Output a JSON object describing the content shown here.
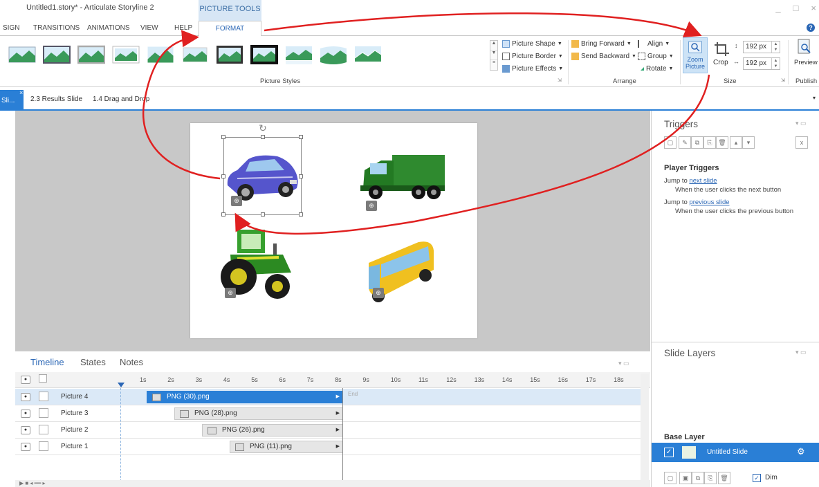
{
  "window": {
    "title": "Untitled1.story* - Articulate Storyline 2",
    "controls": [
      "_",
      "□",
      "×"
    ]
  },
  "ribbon_tabs": {
    "context_group": "PICTURE TOOLS",
    "tabs": [
      "SIGN",
      "TRANSITIONS",
      "ANIMATIONS",
      "VIEW",
      "HELP",
      "FORMAT"
    ]
  },
  "ribbon": {
    "picture_styles_label": "Picture Styles",
    "picture_shape": "Picture Shape",
    "picture_border": "Picture Border",
    "picture_effects": "Picture Effects",
    "bring_forward": "Bring Forward",
    "send_backward": "Send Backward",
    "align": "Align",
    "group": "Group",
    "rotate": "Rotate",
    "arrange_label": "Arrange",
    "zoom_picture": "Zoom Picture",
    "crop": "Crop",
    "height_value": "192 px",
    "width_value": "192 px",
    "size_label": "Size",
    "preview": "Preview",
    "publish_label": "Publish"
  },
  "slide_tabs": {
    "active_tab": "Sli...",
    "tabs": [
      "2.3 Results Slide",
      "1.4 Drag and Drop"
    ]
  },
  "triggers": {
    "title": "Triggers",
    "player_triggers_heading": "Player Triggers",
    "items": [
      {
        "prefix": "Jump to ",
        "link": "next slide",
        "condition": "When the user clicks the next button"
      },
      {
        "prefix": "Jump to ",
        "link": "previous slide",
        "condition": "When the user clicks the previous button"
      }
    ]
  },
  "slide_layers": {
    "title": "Slide Layers",
    "base_layer_label": "Base Layer",
    "base_layer_name": "Untitled Slide",
    "dim_label": "Dim",
    "dim_checked": true
  },
  "timeline": {
    "tabs": [
      "Timeline",
      "States",
      "Notes"
    ],
    "active_tab": "Timeline",
    "ticks": [
      "1s",
      "2s",
      "3s",
      "4s",
      "5s",
      "6s",
      "7s",
      "8s",
      "9s",
      "10s",
      "11s",
      "12s",
      "13s",
      "14s",
      "15s",
      "16s",
      "17s",
      "18s"
    ],
    "end_label": "End",
    "rows": [
      {
        "name": "Picture 4",
        "file": "PNG (30).png",
        "selected": true
      },
      {
        "name": "Picture 3",
        "file": "PNG (28).png",
        "selected": false
      },
      {
        "name": "Picture 2",
        "file": "PNG (26).png",
        "selected": false
      },
      {
        "name": "Picture 1",
        "file": "PNG (11).png",
        "selected": false
      }
    ]
  },
  "colors": {
    "accent": "#2a7fd6",
    "annotation_arrow": "#e02020",
    "canvas_bg": "#c8c8c8"
  },
  "icons": [
    "eye-icon",
    "lock-icon",
    "gear-icon",
    "zoom-icon",
    "crop-icon",
    "preview-icon",
    "rotate-handle-icon"
  ]
}
